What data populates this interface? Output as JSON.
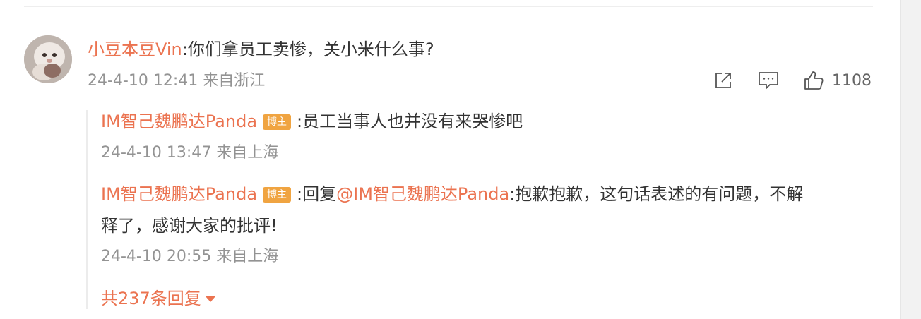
{
  "comment": {
    "username": "小豆本豆Vin",
    "text": ":你们拿员工卖惨，关小米什么事?",
    "timestamp": "24-4-10 12:41 来自浙江",
    "like_count": "1108",
    "icons": {
      "share": "share-icon",
      "reply": "comment-icon",
      "like": "thumbs-up-icon"
    }
  },
  "replies": [
    {
      "username": "IM智己魏鹏达Panda",
      "badge": "博主",
      "text": ":员工当事人也并没有来哭惨吧",
      "timestamp": "24-4-10 13:47 来自上海"
    },
    {
      "username": "IM智己魏鹏达Panda",
      "badge": "博主",
      "text_prefix": ":回复",
      "mention": "@IM智己魏鹏达Panda",
      "text_line1": ":抱歉抱歉，这句话表述的有问题，不解",
      "text_line2": "释了，感谢大家的批评!",
      "timestamp": "24-4-10 20:55 来自上海"
    }
  ],
  "more_replies": {
    "label": "共237条回复",
    "icon": "caret-down-icon"
  },
  "colors": {
    "accent": "#eb7350",
    "badge": "#f0a441",
    "meta": "#939393"
  }
}
